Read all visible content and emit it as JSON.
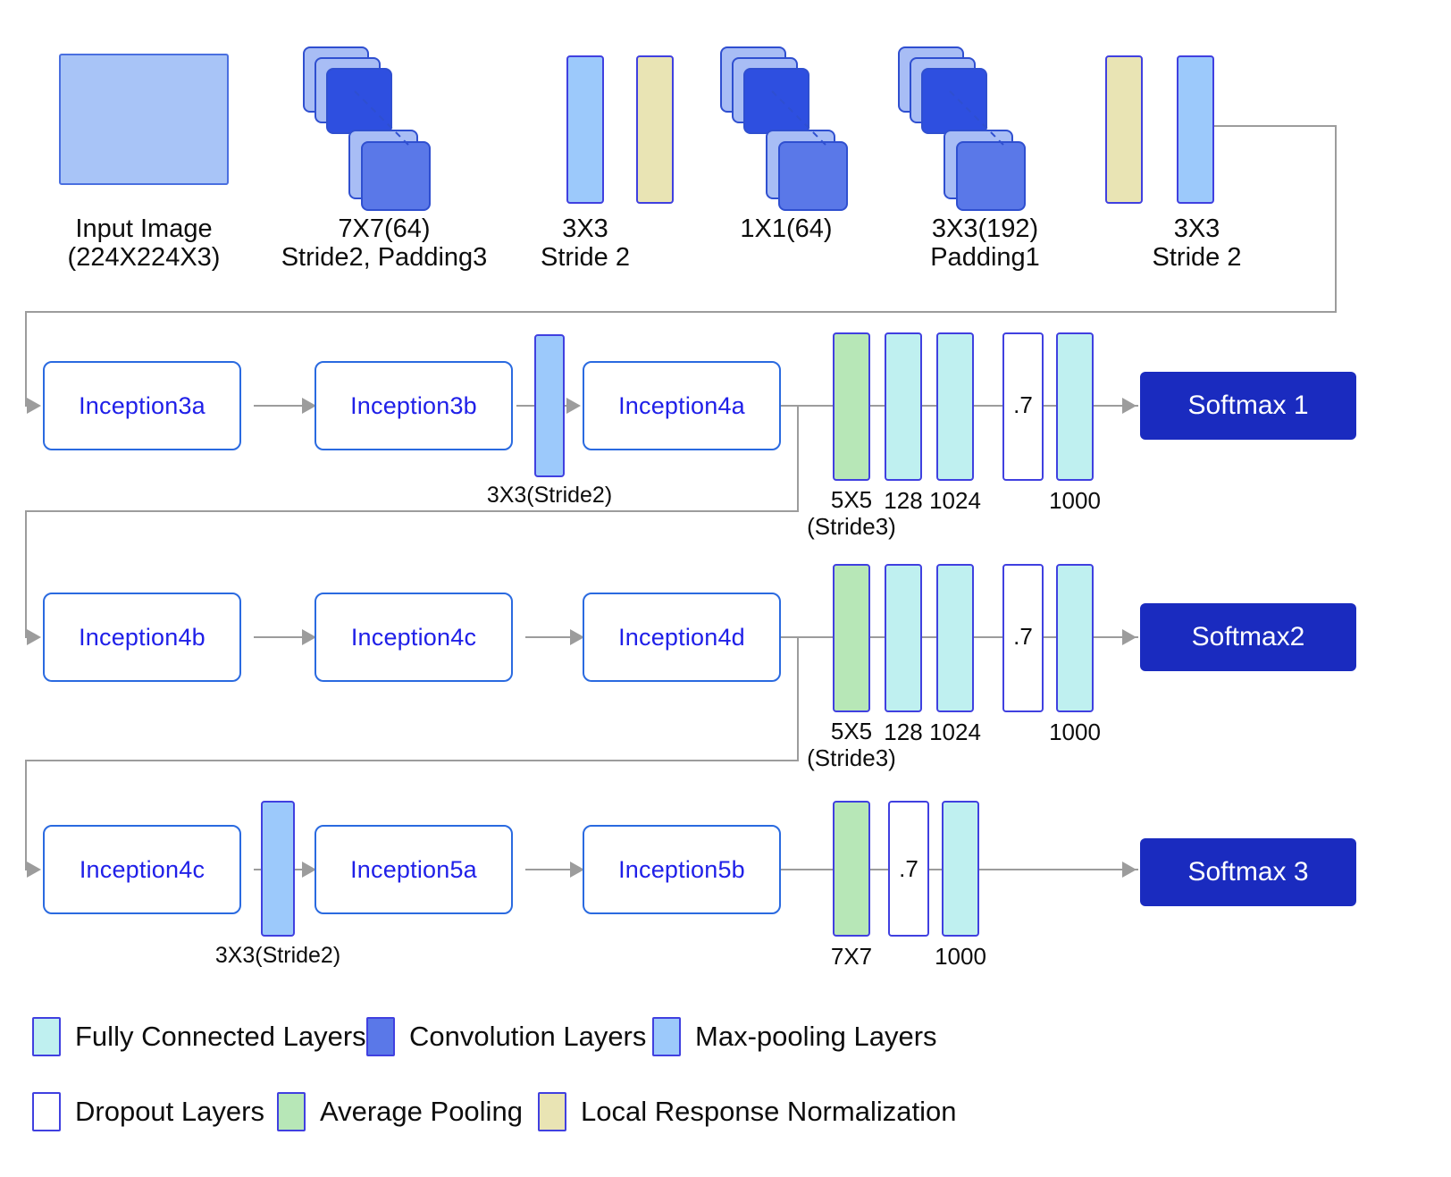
{
  "title": "GoogLeNet / Inception architecture diagram",
  "colors": {
    "fully_connected": "#bff0f0",
    "convolution": "#5a78e8",
    "convolution_light": "#a8bdf5",
    "max_pooling": "#9cc9fb",
    "dropout": "#ffffff",
    "average_pooling": "#b7e7b7",
    "local_response_normalization": "#e9e4b4",
    "input_image": "#a8c4f7",
    "softmax_bg": "#1a2bbf",
    "softmax_text": "#ffffff",
    "inception_border": "#2a6ae0",
    "inception_text": "#2020e8",
    "shape_border": "#4040e0",
    "connector": "#9c9c9c"
  },
  "stem": {
    "blocks": [
      {
        "name": "input-image",
        "kind": "input",
        "label": "Input Image\n(224X224X3)"
      },
      {
        "name": "conv-7x7",
        "kind": "convolution",
        "label": "7X7(64)\nStride2, Padding3"
      },
      {
        "name": "maxpool-3x3-a",
        "kind": "max_pooling",
        "label": "3X3\nStride 2"
      },
      {
        "name": "lrn-a",
        "kind": "local_response_normalization",
        "label": ""
      },
      {
        "name": "conv-1x1",
        "kind": "convolution",
        "label": "1X1(64)"
      },
      {
        "name": "conv-3x3",
        "kind": "convolution",
        "label": "3X3(192)\nPadding1"
      },
      {
        "name": "lrn-b",
        "kind": "local_response_normalization",
        "label": ""
      },
      {
        "name": "maxpool-3x3-b",
        "kind": "max_pooling",
        "label": "3X3\nStride 2"
      }
    ]
  },
  "rows": [
    {
      "id": "row-1",
      "inceptions": [
        "Inception3a",
        "Inception3b",
        "Inception4a"
      ],
      "maxpool_label": "3X3(Stride2)",
      "head_bars": [
        {
          "kind": "average_pooling",
          "label": "5X5\n(Stride3)",
          "inner": ""
        },
        {
          "kind": "fully_connected",
          "label": "128",
          "inner": ""
        },
        {
          "kind": "fully_connected",
          "label": "1024",
          "inner": ""
        },
        {
          "kind": "dropout",
          "label": "",
          "inner": ".7"
        },
        {
          "kind": "fully_connected",
          "label": "1000",
          "inner": ""
        }
      ],
      "softmax": "Softmax 1"
    },
    {
      "id": "row-2",
      "inceptions": [
        "Inception4b",
        "Inception4c",
        "Inception4d"
      ],
      "maxpool_label": "",
      "head_bars": [
        {
          "kind": "average_pooling",
          "label": "5X5\n(Stride3)",
          "inner": ""
        },
        {
          "kind": "fully_connected",
          "label": "128",
          "inner": ""
        },
        {
          "kind": "fully_connected",
          "label": "1024",
          "inner": ""
        },
        {
          "kind": "dropout",
          "label": "",
          "inner": ".7"
        },
        {
          "kind": "fully_connected",
          "label": "1000",
          "inner": ""
        }
      ],
      "softmax": "Softmax2"
    },
    {
      "id": "row-3",
      "inceptions": [
        "Inception4c",
        "Inception5a",
        "Inception5b"
      ],
      "maxpool_label": "3X3(Stride2)",
      "head_bars": [
        {
          "kind": "average_pooling",
          "label": "7X7",
          "inner": ""
        },
        {
          "kind": "dropout",
          "label": "",
          "inner": ".7"
        },
        {
          "kind": "fully_connected",
          "label": "1000",
          "inner": ""
        }
      ],
      "softmax": "Softmax 3"
    }
  ],
  "legend": {
    "row1": [
      {
        "key": "fully_connected",
        "label": "Fully Connected Layers"
      },
      {
        "key": "convolution",
        "label": "Convolution Layers"
      },
      {
        "key": "max_pooling",
        "label": "Max-pooling Layers"
      }
    ],
    "row2": [
      {
        "key": "dropout",
        "label": "Dropout Layers"
      },
      {
        "key": "average_pooling",
        "label": "Average Pooling"
      },
      {
        "key": "local_response_normalization",
        "label": "Local Response Normalization"
      }
    ]
  }
}
